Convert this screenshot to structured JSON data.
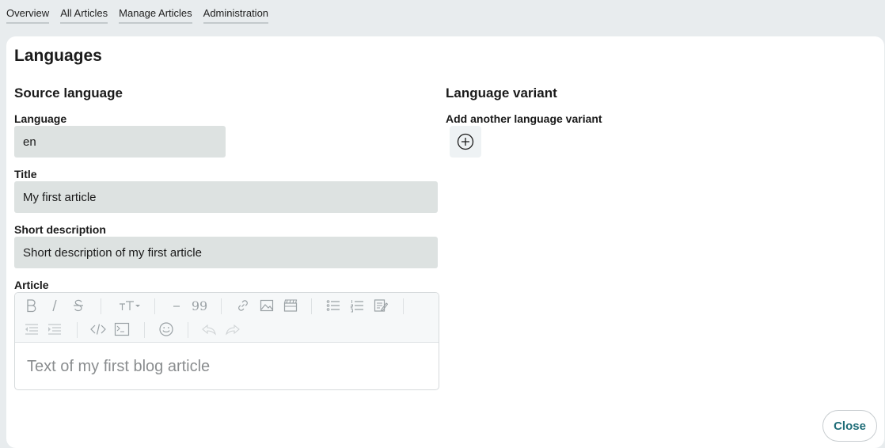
{
  "nav": {
    "tabs": [
      {
        "label": "Overview"
      },
      {
        "label": "All Articles"
      },
      {
        "label": "Manage Articles"
      },
      {
        "label": "Administration"
      }
    ]
  },
  "page": {
    "title": "Languages"
  },
  "source": {
    "heading": "Source language",
    "language": {
      "label": "Language",
      "value": "en"
    },
    "title": {
      "label": "Title",
      "value": "My first article"
    },
    "short_description": {
      "label": "Short description",
      "value": "Short description of my first article"
    },
    "article": {
      "label": "Article",
      "placeholder": "Text of my first blog article"
    }
  },
  "variant": {
    "heading": "Language variant",
    "add_label": "Add another language variant"
  },
  "editor_toolbar": {
    "icons": [
      "bold-icon",
      "italic-icon",
      "strikethrough-icon",
      "text-size-icon",
      "horizontal-rule-icon",
      "blockquote-icon",
      "link-icon",
      "image-icon",
      "video-icon",
      "bulleted-list-icon",
      "numbered-list-icon",
      "checklist-icon",
      "outdent-icon",
      "indent-icon",
      "code-icon",
      "code-block-icon",
      "emoji-icon",
      "undo-icon",
      "redo-icon"
    ],
    "blockquote_glyph": "99"
  },
  "actions": {
    "close_label": "Close"
  },
  "colors": {
    "background": "#e8ecee",
    "input_fill": "#dde2e1",
    "accent": "#1f6d78",
    "toolbar_icon": "#9aa1a5"
  }
}
